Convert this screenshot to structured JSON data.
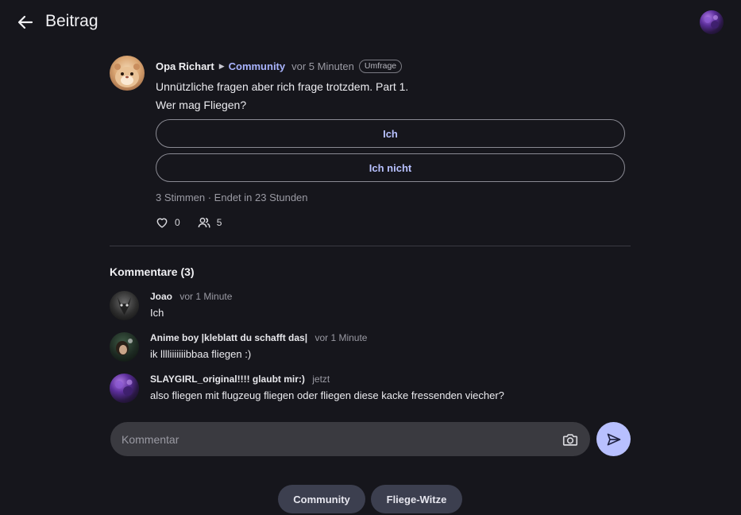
{
  "header": {
    "title": "Beitrag",
    "back_icon": "arrow-left-icon"
  },
  "post": {
    "author": "Opa Richart",
    "community": "Community",
    "time": "vor 5 Minuten",
    "badge": "Umfrage",
    "text_line1": "Unnützliche fragen aber rich frage trotzdem. Part 1.",
    "text_line2": "Wer mag Fliegen?",
    "poll_options": [
      "Ich",
      "Ich nicht"
    ],
    "poll_status": "3 Stimmen · Endet in 23 Stunden",
    "likes": "0",
    "participants": "5"
  },
  "comments": {
    "title": "Kommentare (3)",
    "items": [
      {
        "author": "Joao",
        "time": "vor 1 Minute",
        "text": "Ich"
      },
      {
        "author": "Anime boy |kleblatt du schafft das|",
        "time": "vor 1 Minute",
        "text": "ik lllliiiiiiibbaa fliegen :)"
      },
      {
        "author": "SLAYGIRL_original!!!! glaubt mir:)",
        "time": "jetzt",
        "text": "also fliegen mit flugzeug fliegen oder fliegen diese kacke fressenden viecher?"
      }
    ]
  },
  "composer": {
    "placeholder": "Kommentar",
    "camera_icon": "camera-icon",
    "send_icon": "send-icon"
  },
  "tags": [
    "Community",
    "Fliege-Witze"
  ],
  "colors": {
    "background": "#16161c",
    "accent": "#a9b4ff",
    "send_button": "#b8c0ff",
    "tag_bg": "#3c3f4f"
  }
}
